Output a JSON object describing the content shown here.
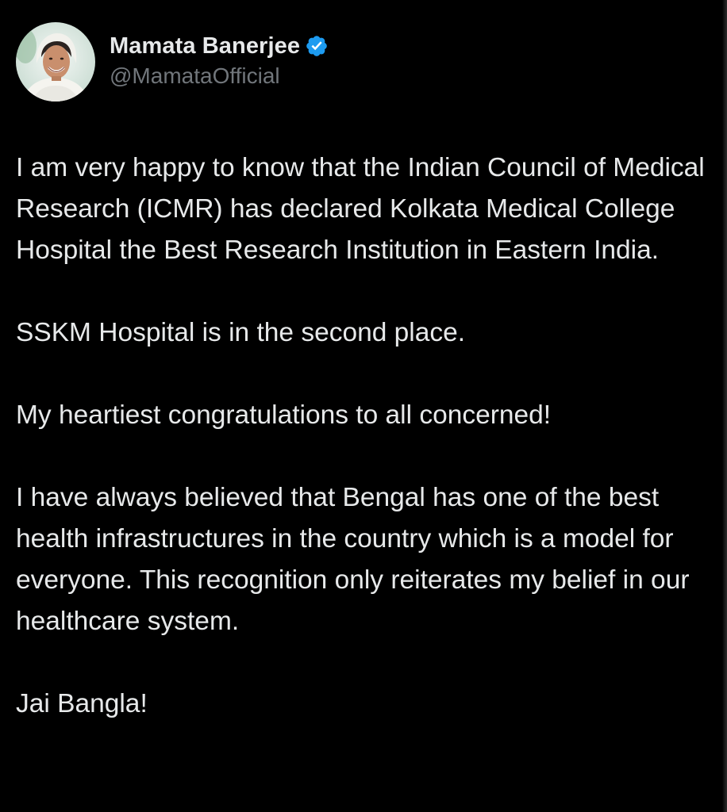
{
  "author": {
    "display_name": "Mamata Banerjee",
    "handle": "@MamataOfficial",
    "verified_icon": "verified-badge-icon",
    "verified_color": "#1d9bf0"
  },
  "tweet": {
    "paragraphs": [
      "I am very happy to know that the Indian Council of Medical Research (ICMR) has declared Kolkata Medical College Hospital the Best Research Institution in Eastern India.",
      "SSKM Hospital is in the second place.",
      "My heartiest congratulations to all concerned!",
      "I have always believed that Bengal has one of the best health infrastructures in the country which is a model for everyone. This recognition only reiterates my belief in our healthcare system.",
      "Jai Bangla!"
    ]
  },
  "colors": {
    "background": "#000000",
    "text": "#e7e9ea",
    "secondary_text": "#71767b"
  }
}
